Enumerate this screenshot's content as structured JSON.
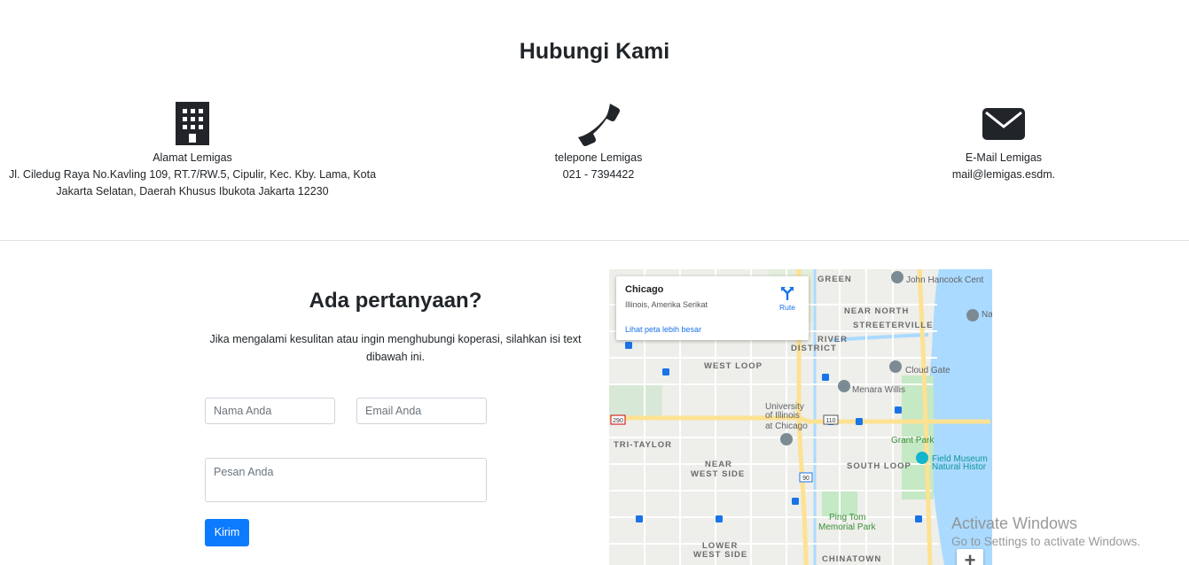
{
  "page": {
    "title": "Hubungi Kami"
  },
  "contact": {
    "address": {
      "icon": "building-icon",
      "label": "Alamat Lemigas",
      "line1": "Jl. Ciledug Raya No.Kavling 109, RT.7/RW.5, Cipulir, Kec. Kby. Lama, Kota",
      "line2": "Jakarta Selatan, Daerah Khusus Ibukota Jakarta 12230"
    },
    "phone": {
      "icon": "phone-icon",
      "label": "telepone Lemigas",
      "value": "021 - 7394422"
    },
    "email": {
      "icon": "envelope-icon",
      "label": "E-Mail Lemigas",
      "value": "mail@lemigas.esdm."
    }
  },
  "form": {
    "title": "Ada pertanyaan?",
    "description_line1": "Jika mengalami kesulitan atau ingin menghubungi koperasi, silahkan isi text",
    "description_line2": "dibawah ini.",
    "name_placeholder": "Nama Anda",
    "email_placeholder": "Email Anda",
    "message_placeholder": "Pesan Anda",
    "submit_label": "Kirim"
  },
  "map": {
    "card": {
      "city": "Chicago",
      "region": "Illinois, Amerika Serikat",
      "route_label": "Rute",
      "larger_map_link": "Lihat peta lebih besar"
    },
    "labels": {
      "green": "GREEN",
      "hancock": "John Hancock Cent",
      "near_north": "NEAR NORTH",
      "streeterville": "STREETERVILLE",
      "navy_pier_partial": "Na",
      "river_a": "RIVER",
      "district": "DISTRICT",
      "west_loop": "WEST LOOP",
      "cloud_gate": "Cloud Gate",
      "menara_willis": "Menara Willis",
      "university": "University",
      "of_illinois": "of Illinois",
      "at_chicago": "at Chicago",
      "tri_taylor": "TRI-TAYLOR",
      "grant_park": "Grant Park",
      "field_museum": "Field Museum",
      "natural_history": "Natural Histor",
      "near": "NEAR",
      "west_side": "WEST SIDE",
      "south_loop": "SOUTH LOOP",
      "ping_tom": "Ping Tom",
      "memorial_park": "Memorial Park",
      "lower": "LOWER",
      "west_side_2": "WEST SIDE",
      "chinatown": "CHINATOWN",
      "hwy_290": "290",
      "hwy_90": "90",
      "hwy_110": "110"
    },
    "zoom_in": "+"
  },
  "watermark": {
    "line1": "Activate Windows",
    "line2": "Go to Settings to activate Windows."
  },
  "colors": {
    "primary": "#0d7bfd",
    "text": "#212529",
    "map_water": "#aadaff",
    "map_park": "#c5e8c5",
    "map_highway": "#fde293"
  }
}
